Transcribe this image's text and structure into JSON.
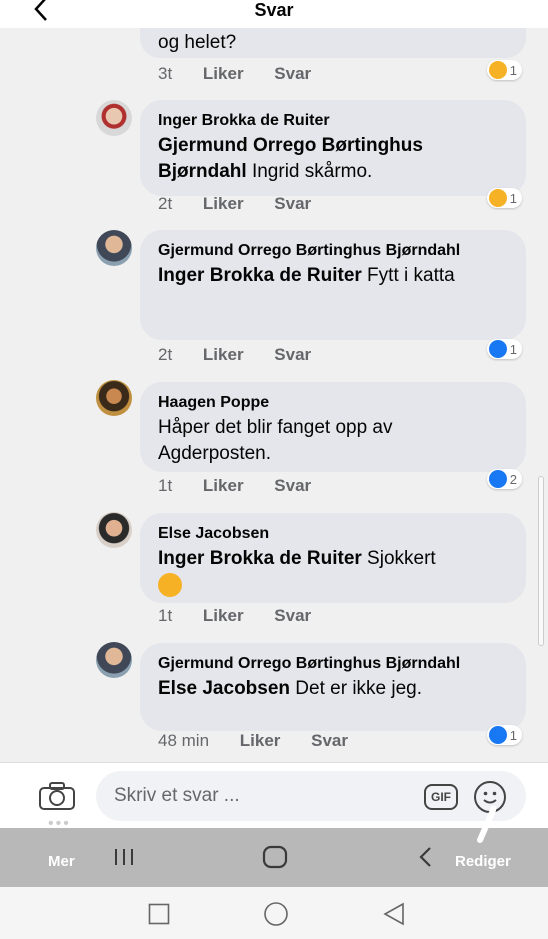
{
  "header": {
    "title": "Svar",
    "faded_text": ""
  },
  "partial": {
    "text": "og helet?",
    "time": "3t",
    "like": "Liker",
    "reply": "Svar",
    "reaction_count": "1"
  },
  "comments": [
    {
      "author": "Inger Brokka de Ruiter",
      "mention": "Gjermund Orrego Børtinghus Bjørndahl",
      "text": " Ingrid skårmo.",
      "time": "2t",
      "like": "Liker",
      "reply": "Svar",
      "reaction": "sad",
      "reaction_count": "1"
    },
    {
      "author": "Gjermund Orrego Børtinghus Bjørndahl",
      "mention": "Inger Brokka de Ruiter",
      "text": " Fytt i katta",
      "time": "2t",
      "like": "Liker",
      "reply": "Svar",
      "reaction": "like",
      "reaction_count": "1"
    },
    {
      "author": "Haagen Poppe",
      "mention": "",
      "text": "Håper det blir fanget opp av Agderposten.",
      "time": "1t",
      "like": "Liker",
      "reply": "Svar",
      "reaction": "like",
      "reaction_count": "2"
    },
    {
      "author": "Else Jacobsen",
      "mention": "Inger Brokka de Ruiter",
      "text": " Sjokkert",
      "time": "1t",
      "like": "Liker",
      "reply": "Svar",
      "reaction": "none",
      "reaction_count": ""
    },
    {
      "author": "Gjermund Orrego Børtinghus Bjørndahl",
      "mention": "Else Jacobsen",
      "text": " Det er ikke jeg.",
      "time": "48 min",
      "like": "Liker",
      "reply": "Svar",
      "reaction": "like",
      "reaction_count": "1"
    }
  ],
  "reply_bar": {
    "placeholder": "Skriv et svar ...",
    "gif_label": "GIF"
  },
  "overlay": {
    "left_label": "Mer",
    "right_label": "Rediger"
  },
  "colors": {
    "like": "#1877f2",
    "sad": "#f7b125",
    "bubble": "#e4e6eb",
    "feed_bg": "#f0f0f0"
  },
  "icons": [
    "back-arrow-icon",
    "camera-icon",
    "gif-icon",
    "smiley-icon",
    "pen-icon",
    "recents-icon",
    "home-icon",
    "back-icon"
  ]
}
